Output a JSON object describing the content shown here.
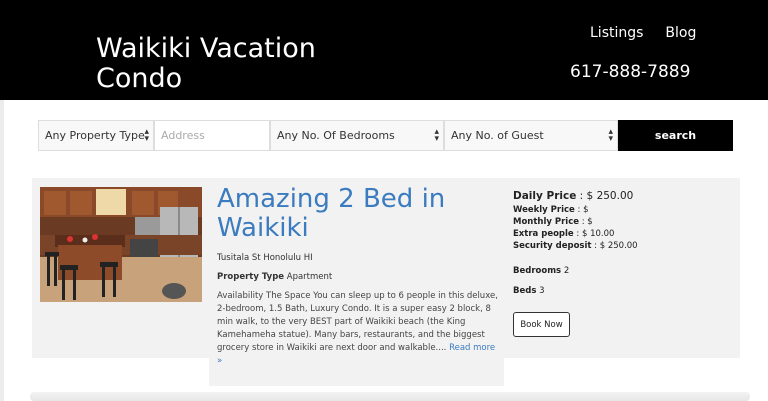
{
  "header": {
    "site_title": "Waikiki Vacation Condo",
    "nav": [
      "Listings",
      "Blog"
    ],
    "phone": "617-888-7889"
  },
  "search": {
    "property_type": "Any Property Type",
    "address_placeholder": "Address",
    "bedrooms": "Any No. Of Bedrooms",
    "guests": "Any No. of Guest",
    "button": "search"
  },
  "listing": {
    "title": "Amazing 2 Bed in Waikiki",
    "address": "Tusitala St Honolulu HI",
    "property_type_label": "Property Type",
    "property_type_value": "Apartment",
    "description": "Availability The Space You can sleep up to 6 people in this deluxe, 2-bedroom, 1.5 Bath, Luxury Condo. It is a super easy 2 block, 8 min walk, to the very BEST part of Waikiki beach (the King Kamehameha statue). Many bars, restaurants, and the biggest grocery store in Waikiki are next door and walkable....",
    "read_more": "Read more »",
    "daily_price_label": "Daily Price",
    "daily_price_value": ": $ 250.00",
    "weekly_price_label": "Weekly Price",
    "weekly_price_value": ": $",
    "monthly_price_label": "Monthly Price",
    "monthly_price_value": ": $",
    "extra_people_label": "Extra people",
    "extra_people_value": ": $ 10.00",
    "security_deposit_label": "Security deposit",
    "security_deposit_value": ": $ 250.00",
    "bedrooms_label": "Bedrooms",
    "bedrooms_value": "2",
    "beds_label": "Beds",
    "beds_value": "3",
    "book_button": "Book Now"
  }
}
